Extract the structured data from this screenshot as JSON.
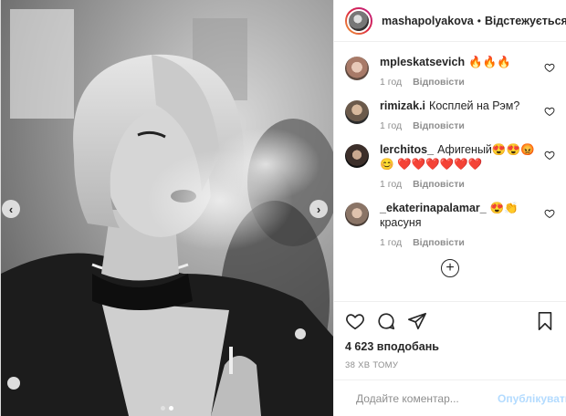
{
  "post": {
    "username": "mashapolyakova",
    "separator": "•",
    "follow_label": "Відстежується",
    "more_label": "•••"
  },
  "comments": [
    {
      "username": "mpleskatsevich",
      "text": "🔥🔥🔥",
      "time": "1 год",
      "reply_label": "Відповісти"
    },
    {
      "username": "rimizak.i",
      "text": "Косплей на Рэм?",
      "time": "1 год",
      "reply_label": "Відповісти"
    },
    {
      "username": "lerchitos_",
      "text": "Афигеный😍😍😡😊 ❤️❤️❤️❤️❤️❤️",
      "time": "1 год",
      "reply_label": "Відповісти"
    },
    {
      "username": "_ekaterinapalamar_",
      "text": "😍👏 красуня",
      "time": "1 год",
      "reply_label": "Відповісти"
    }
  ],
  "load_more_label": "+",
  "likes_text": "4 623 вподобань",
  "time_ago": "38 ХВ ТОМУ",
  "comment_input": {
    "placeholder": "Додайте коментар...",
    "value": ""
  },
  "post_button": "Опублікувати",
  "carousel": {
    "prev": "‹",
    "next": "›"
  },
  "icons": {
    "like": "heart-icon",
    "comment": "comment-icon",
    "share": "share-icon",
    "save": "bookmark-icon",
    "emoji": "emoji-icon"
  },
  "colors": {
    "post_button": "#b3dbff",
    "muted_text": "#8e8e8e",
    "text": "#262626"
  }
}
